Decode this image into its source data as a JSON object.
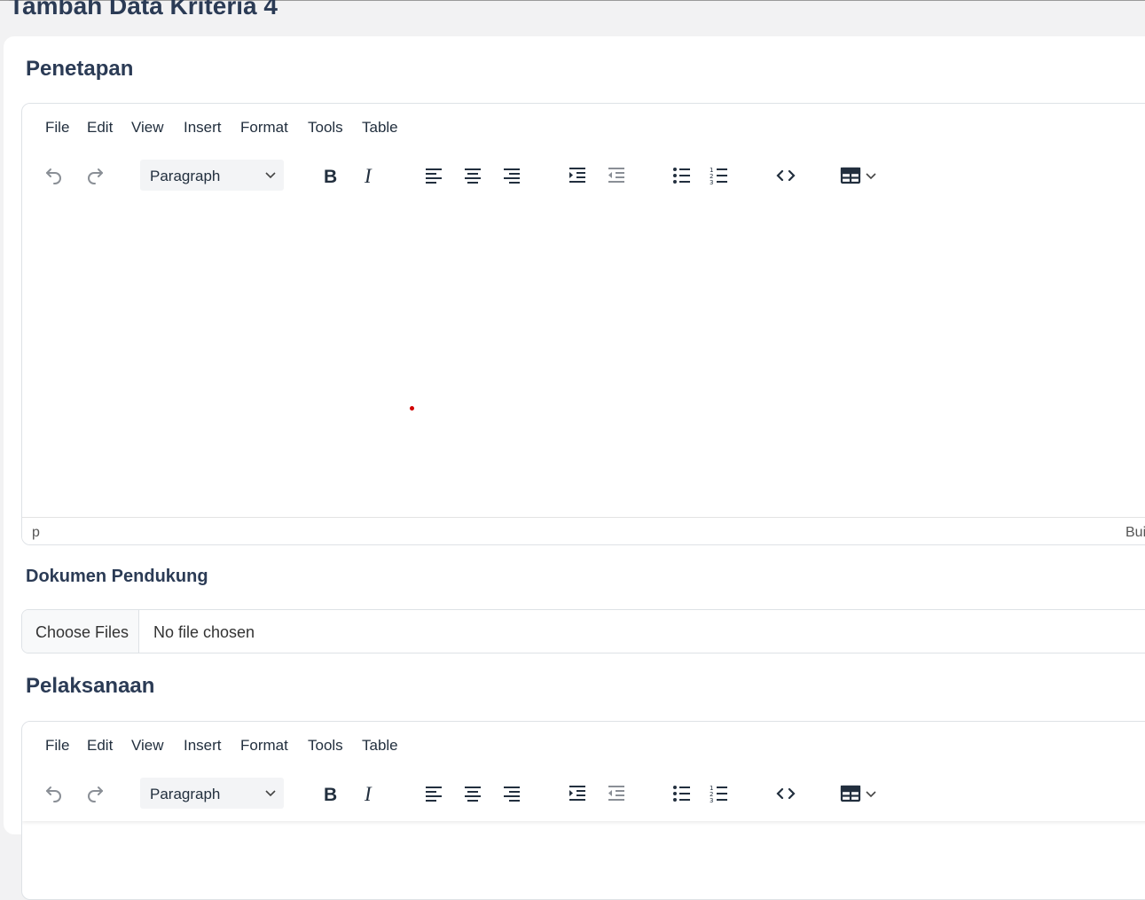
{
  "page": {
    "title": "Tambah Data Kriteria 4"
  },
  "editor_menu": [
    "File",
    "Edit",
    "View",
    "Insert",
    "Format",
    "Tools",
    "Table"
  ],
  "editor_toolbar": {
    "block_format": "Paragraph",
    "icons": [
      "undo-icon",
      "redo-icon",
      "bold-icon",
      "italic-icon",
      "align-left-icon",
      "align-center-icon",
      "align-right-icon",
      "indent-icon",
      "outdent-icon",
      "bullet-list-icon",
      "numbered-list-icon",
      "code-icon",
      "table-icon"
    ]
  },
  "penetapan": {
    "title": "Penetapan",
    "status_path": "p",
    "status_brand": "Bui"
  },
  "dokumen": {
    "label": "Dokumen Pendukung",
    "button": "Choose Files",
    "status": "No file chosen"
  },
  "pelaksanaan": {
    "title": "Pelaksanaan"
  },
  "colors": {
    "heading": "#2b3b55",
    "page_bg": "#f2f2f3",
    "icon": "#222f3e",
    "icon_disabled": "#8a8f96"
  }
}
